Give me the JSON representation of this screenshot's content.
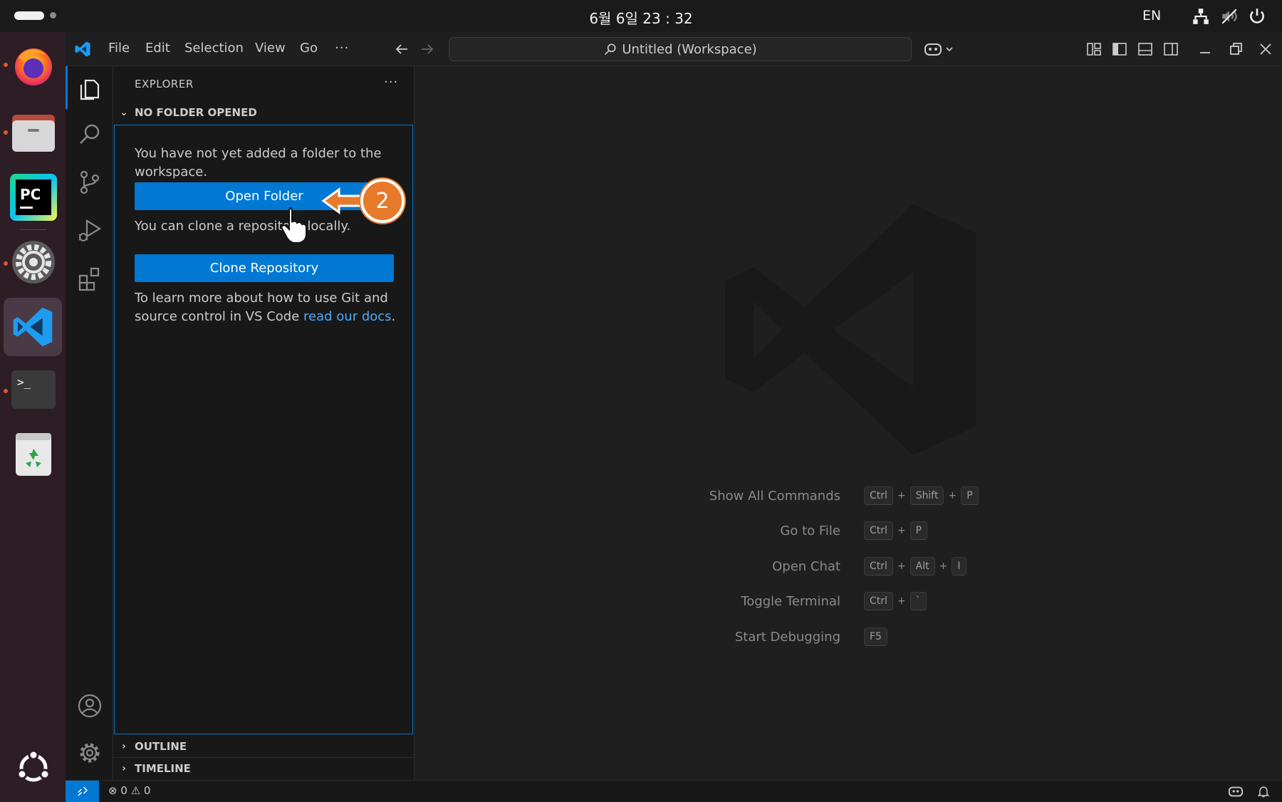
{
  "topbar": {
    "clock": "6월 6일 23 : 32",
    "lang": "EN"
  },
  "menu": {
    "file": "File",
    "edit": "Edit",
    "selection": "Selection",
    "view": "View",
    "go": "Go",
    "more": "···"
  },
  "command_center": {
    "label": "Untitled (Workspace)"
  },
  "explorer": {
    "title": "EXPLORER",
    "more": "···",
    "section": "NO FOLDER OPENED",
    "msg1": "You have not yet added a folder to the workspace.",
    "open_folder": "Open Folder",
    "msg2": "You can clone a repository locally.",
    "clone_repo": "Clone Repository",
    "msg3_pre": "To learn more about how to use Git and source control in VS Code ",
    "msg3_link": "read our docs",
    "msg3_post": ".",
    "outline": "OUTLINE",
    "timeline": "TIMELINE"
  },
  "shortcuts": [
    {
      "label": "Show All Commands",
      "keys": [
        "Ctrl",
        "Shift",
        "P"
      ]
    },
    {
      "label": "Go to File",
      "keys": [
        "Ctrl",
        "P"
      ]
    },
    {
      "label": "Open Chat",
      "keys": [
        "Ctrl",
        "Alt",
        "I"
      ]
    },
    {
      "label": "Toggle Terminal",
      "keys": [
        "Ctrl",
        "`"
      ]
    },
    {
      "label": "Start Debugging",
      "keys": [
        "F5"
      ]
    }
  ],
  "status": {
    "errors": "0",
    "warnings": "0"
  },
  "callout": {
    "number": "2"
  },
  "colors": {
    "accent": "#0078d4",
    "callout": "#e77a2b",
    "dock": "#2d1d25"
  }
}
